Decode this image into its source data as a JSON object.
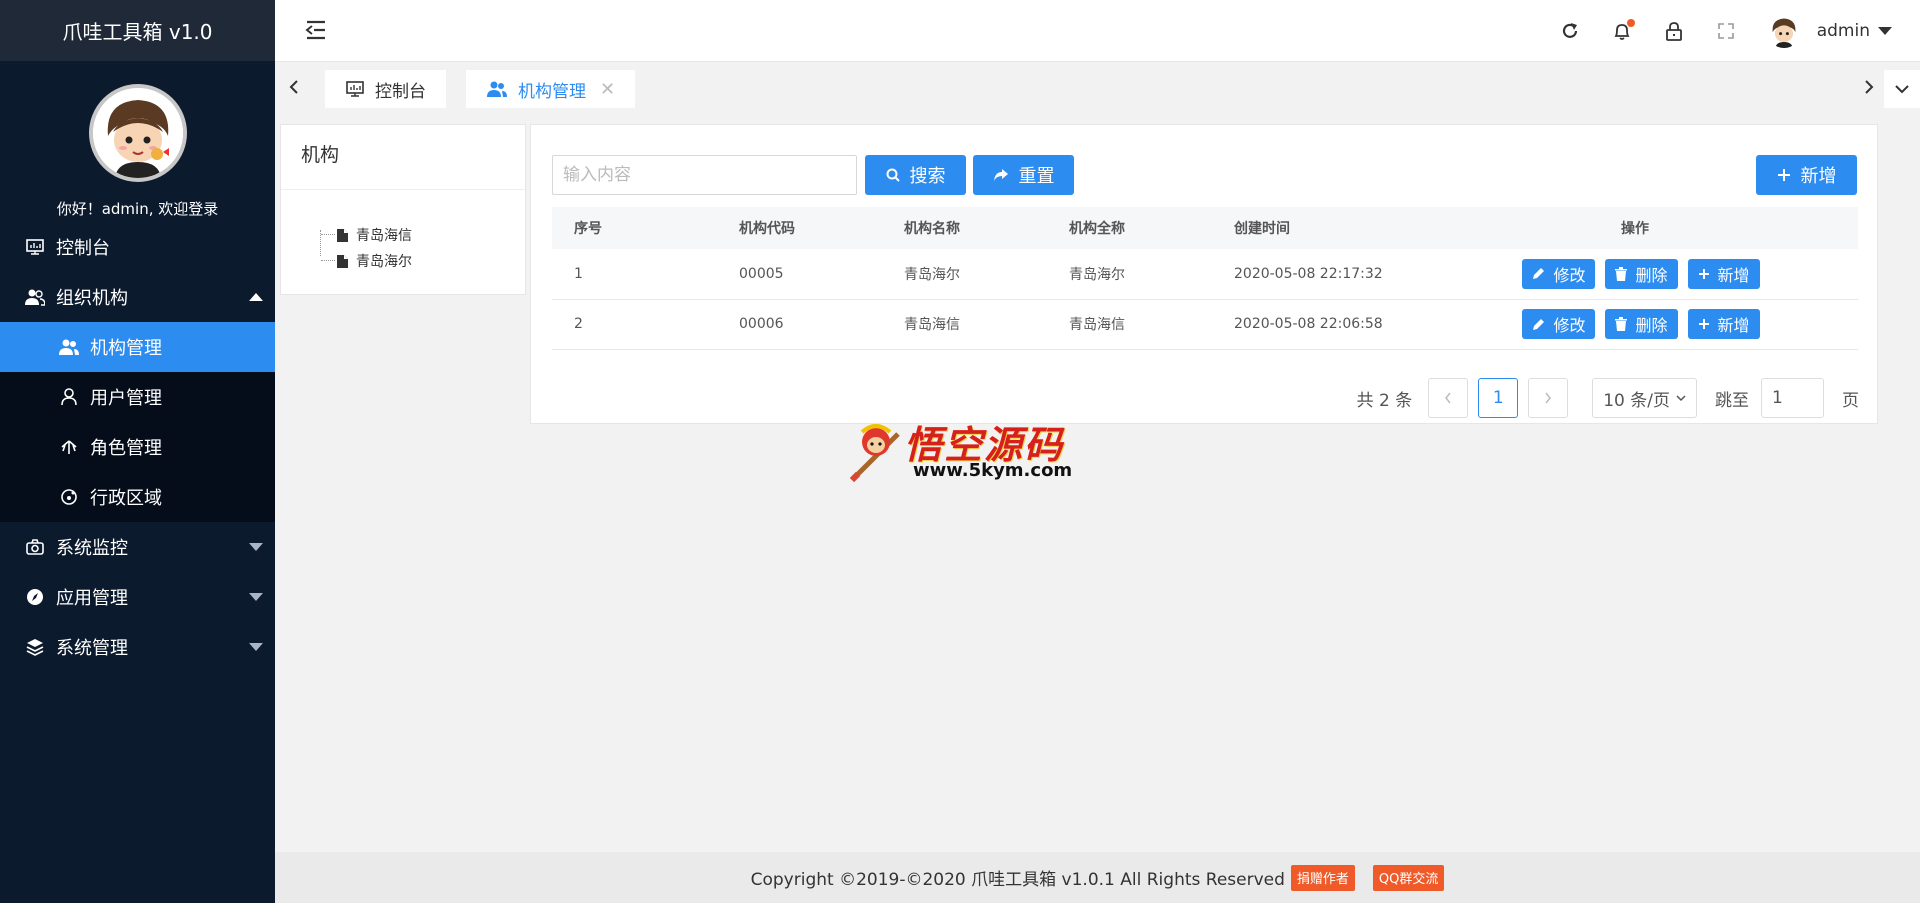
{
  "app": {
    "title": "爪哇工具箱 v1.0",
    "greeting": "你好！admin, 欢迎登录"
  },
  "sidebar": {
    "items": [
      {
        "label": "控制台",
        "icon": "monitor-icon"
      },
      {
        "label": "组织机构",
        "icon": "users-icon",
        "expanded": true,
        "children": [
          {
            "label": "机构管理",
            "icon": "users-icon",
            "active": true
          },
          {
            "label": "用户管理",
            "icon": "user-icon"
          },
          {
            "label": "角色管理",
            "icon": "role-icon"
          },
          {
            "label": "行政区域",
            "icon": "region-icon"
          }
        ]
      },
      {
        "label": "系统监控",
        "icon": "camera-icon"
      },
      {
        "label": "应用管理",
        "icon": "compass-icon"
      },
      {
        "label": "系统管理",
        "icon": "layers-icon"
      }
    ]
  },
  "header": {
    "username": "admin"
  },
  "tabs": [
    {
      "label": "控制台",
      "icon": "monitor-icon"
    },
    {
      "label": "机构管理",
      "icon": "users-icon",
      "active": true
    }
  ],
  "org_tree": {
    "title": "机构",
    "nodes": [
      "青岛海信",
      "青岛海尔"
    ]
  },
  "search": {
    "placeholder": "输入内容",
    "search_label": "搜索",
    "reset_label": "重置",
    "add_label": "新增"
  },
  "table": {
    "columns": [
      "序号",
      "机构代码",
      "机构名称",
      "机构全称",
      "创建时间",
      "操作"
    ],
    "rows": [
      [
        "1",
        "00005",
        "青岛海尔",
        "青岛海尔",
        "2020-05-08 22:17:32"
      ],
      [
        "2",
        "00006",
        "青岛海信",
        "青岛海信",
        "2020-05-08 22:06:58"
      ]
    ],
    "actions": [
      "修改",
      "删除",
      "新增"
    ]
  },
  "pager": {
    "total": "共 2 条",
    "current_page": "1",
    "page_size": "10 条/页",
    "goto_label": "跳至",
    "goto_value": "1",
    "page_suffix": "页"
  },
  "watermark": {
    "title": "悟空源码",
    "url": "www.5kym.com"
  },
  "footer": {
    "copyright": "Copyright ©2019-©2020 爪哇工具箱 v1.0.1 All Rights Reserved",
    "donate": "捐赠作者",
    "qq": "QQ群交流"
  },
  "colors": {
    "primary": "#2d8cf0",
    "sidebar_bg": "#0c1a2e",
    "badge": "#f05a28"
  }
}
